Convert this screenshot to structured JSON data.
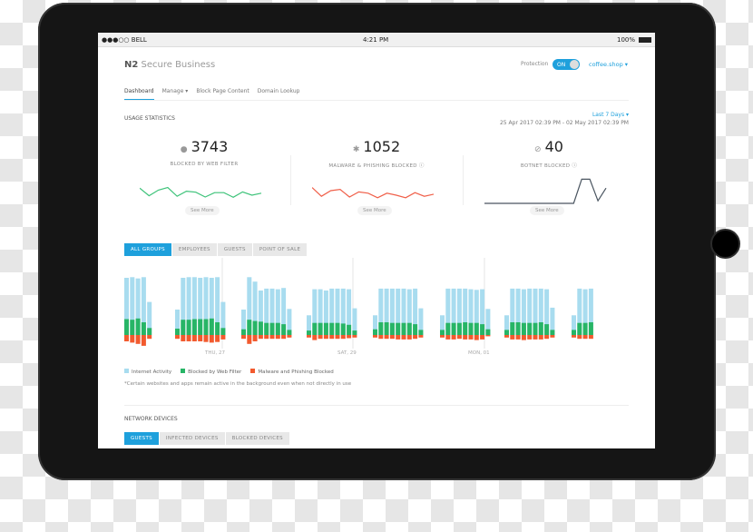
{
  "status_bar": {
    "carrier": "●●●○○ BELL",
    "time": "4:21 PM",
    "battery": "100%"
  },
  "header": {
    "brand_bold": "N2",
    "brand_rest": " Secure Business",
    "protection_label": "Protection",
    "toggle_state": "ON",
    "toggle_on": true,
    "account": "coffee.shop ▾"
  },
  "nav": {
    "items": [
      "Dashboard",
      "Manage ▾",
      "Block Page Content",
      "Domain Lookup"
    ],
    "active": "Dashboard"
  },
  "usage": {
    "title": "USAGE STATISTICS",
    "range_select": "Last 7 Days ▾",
    "range_text": "25 Apr 2017 02:39 PM - 02 May 2017 02:39 PM"
  },
  "stats": [
    {
      "icon": "globe-icon",
      "glyph": "●",
      "value": "3743",
      "label": "BLOCKED BY WEB FILTER",
      "see_more": "See More",
      "color": "#3ec37a"
    },
    {
      "icon": "bug-icon",
      "glyph": "✱",
      "value": "1052",
      "label": "MALWARE & PHISHING BLOCKED ⓘ",
      "see_more": "See More",
      "color": "#f0604a"
    },
    {
      "icon": "block-icon",
      "glyph": "⊘",
      "value": "40",
      "label": "BOTNET BLOCKED ⓘ",
      "see_more": "See More",
      "color": "#4a5560"
    }
  ],
  "group_tabs": {
    "items": [
      "ALL GROUPS",
      "EMPLOYEES",
      "GUESTS",
      "POINT OF SALE"
    ],
    "active": "ALL GROUPS"
  },
  "chart_data": {
    "type": "bar",
    "stacked": true,
    "x_tick_labels": [
      "THU, 27",
      "SAT, 29",
      "MON, 01"
    ],
    "legend": [
      {
        "name": "Internet Activity",
        "color": "#a8dcef"
      },
      {
        "name": "Blocked by Web Filter",
        "color": "#27b566"
      },
      {
        "name": "Malware and Phishing Blocked",
        "color": "#f25a2e"
      }
    ],
    "legend_placement": "bottom-left",
    "groups": [
      {
        "activity": [
          90,
          91,
          89,
          91,
          52
        ],
        "web_filter": [
          25,
          24,
          26,
          20,
          11
        ],
        "malware": [
          10,
          12,
          14,
          17,
          6
        ]
      },
      {
        "activity": [
          40,
          90,
          91,
          91,
          90,
          91,
          90,
          91,
          52
        ],
        "web_filter": [
          10,
          24,
          24,
          25,
          25,
          25,
          26,
          20,
          11
        ],
        "malware": [
          6,
          10,
          10,
          10,
          10,
          11,
          12,
          11,
          7
        ]
      },
      {
        "activity": [
          40,
          91,
          84,
          70,
          73,
          73,
          72,
          74,
          41
        ],
        "web_filter": [
          9,
          24,
          22,
          21,
          19,
          19,
          19,
          17,
          8
        ],
        "malware": [
          6,
          14,
          10,
          6,
          6,
          6,
          6,
          6,
          4
        ]
      },
      {
        "activity": [
          31,
          72,
          72,
          70,
          73,
          73,
          73,
          72,
          42
        ],
        "web_filter": [
          7,
          19,
          19,
          19,
          19,
          19,
          18,
          16,
          7
        ],
        "malware": [
          4,
          8,
          6,
          6,
          6,
          6,
          6,
          5,
          4
        ]
      },
      {
        "activity": [
          31,
          73,
          73,
          73,
          73,
          73,
          72,
          73,
          42
        ],
        "web_filter": [
          9,
          20,
          20,
          19,
          19,
          19,
          19,
          17,
          8
        ],
        "malware": [
          4,
          6,
          6,
          6,
          7,
          7,
          7,
          6,
          4
        ]
      },
      {
        "activity": [
          31,
          73,
          73,
          73,
          73,
          72,
          71,
          72,
          41
        ],
        "web_filter": [
          8,
          19,
          19,
          19,
          20,
          19,
          19,
          17,
          9
        ],
        "malware": [
          4,
          7,
          7,
          6,
          7,
          7,
          8,
          7,
          2
        ]
      },
      {
        "activity": [
          31,
          73,
          73,
          72,
          73,
          73,
          73,
          72,
          43
        ],
        "web_filter": [
          8,
          20,
          20,
          19,
          19,
          19,
          20,
          17,
          8
        ],
        "malware": [
          4,
          7,
          7,
          8,
          7,
          7,
          7,
          6,
          4
        ]
      },
      {
        "activity": [
          31,
          73,
          72,
          73
        ],
        "web_filter": [
          8,
          19,
          19,
          20
        ],
        "malware": [
          4,
          6,
          6,
          6
        ]
      }
    ]
  },
  "footnote": "*Certain websites and apps remain active in the background even when not directly in use",
  "network": {
    "title": "NETWORK DEVICES",
    "tabs": [
      "GUESTS",
      "INFECTED DEVICES",
      "BLOCKED DEVICES"
    ],
    "active": "GUESTS"
  },
  "sparklines": {
    "web_filter": [
      60,
      30,
      52,
      62,
      28,
      48,
      44,
      25,
      42,
      42,
      24,
      45,
      32,
      40
    ],
    "malware": [
      62,
      28,
      50,
      55,
      25,
      45,
      40,
      22,
      40,
      32,
      22,
      42,
      28,
      36
    ],
    "botnet": [
      0,
      0,
      0,
      0,
      0,
      0,
      0,
      0,
      0,
      0,
      0,
      0,
      95,
      95,
      10,
      60
    ]
  }
}
